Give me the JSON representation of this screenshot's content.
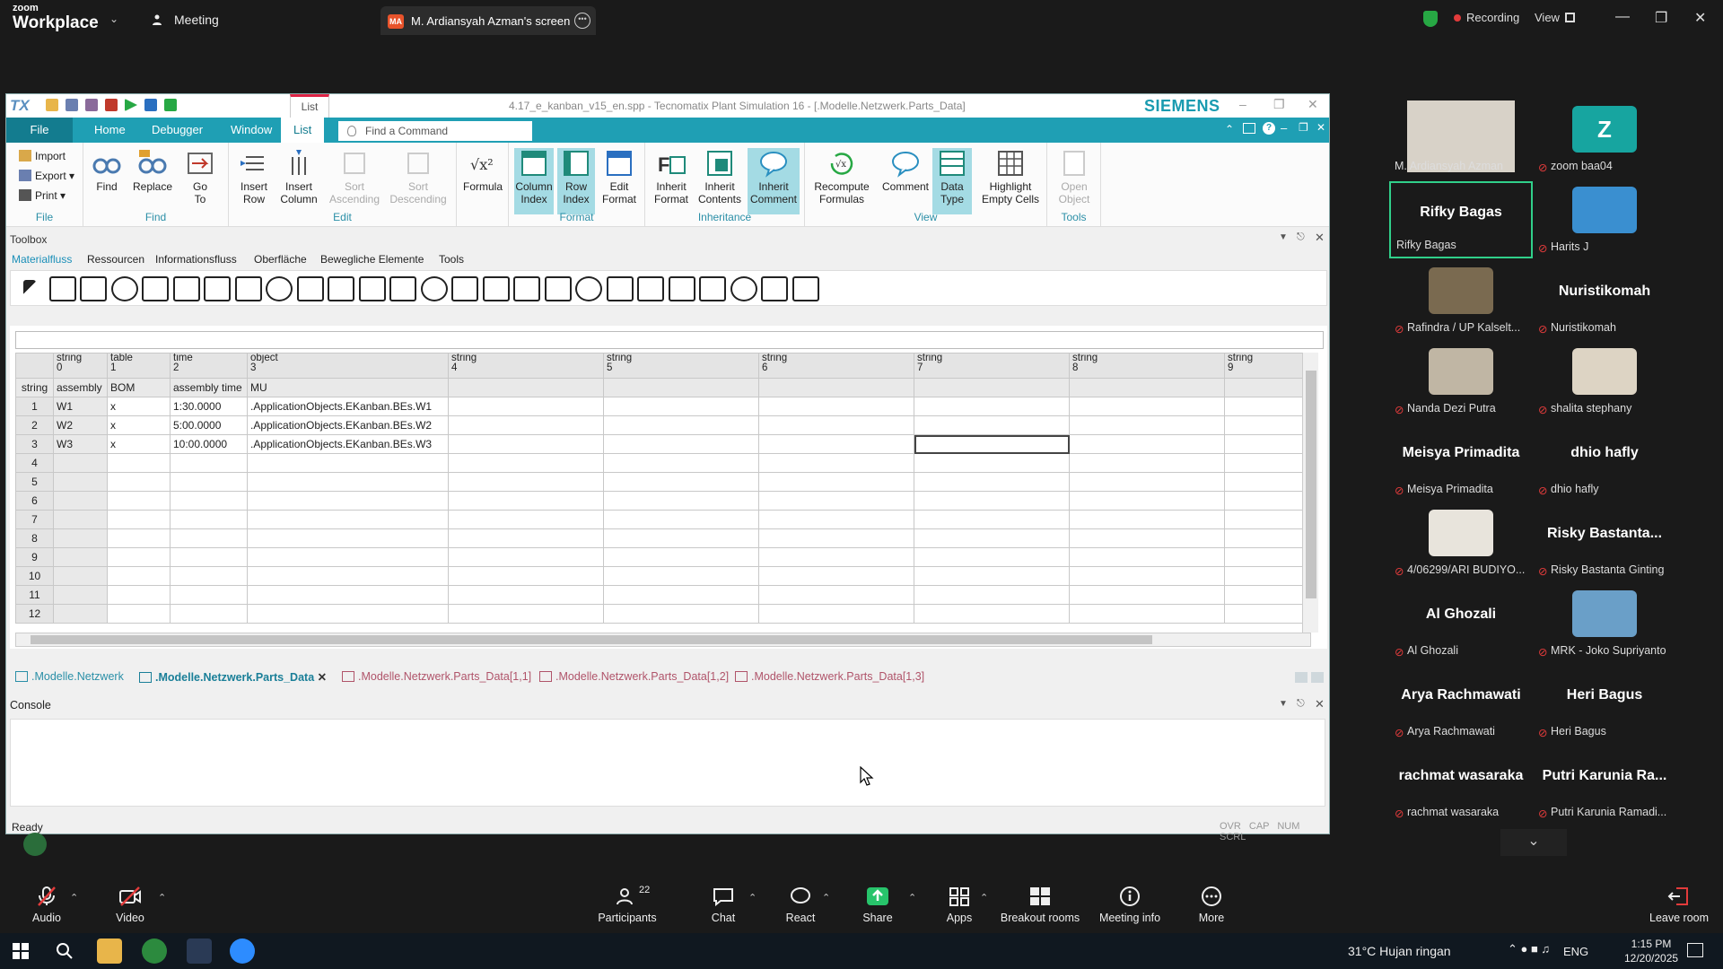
{
  "zoom": {
    "brand_line1": "zoom",
    "brand_line2": "Workplace",
    "meeting_label": "Meeting",
    "share_badge": "MA",
    "share_title": "M. Ardiansyah Azman's screen",
    "recording_label": "Recording",
    "view_label": "View",
    "colors": {
      "bar": "#1a1a1a",
      "recording": "#e23b3b",
      "active_tile": "#30d08a"
    }
  },
  "plantsim": {
    "logo": "TX",
    "list_tab": "List",
    "window_title": "4.17_e_kanban_v15_en.spp - Tecnomatix Plant Simulation 16 - [.Modelle.Netzwerk.Parts_Data]",
    "brand": "SIEMENS",
    "menu": [
      "File",
      "Home",
      "Debugger",
      "Window",
      "List"
    ],
    "find_command_placeholder": "Find a Command",
    "ribbon": {
      "file": {
        "label": "File",
        "items": [
          "Import",
          "Export",
          "Print"
        ]
      },
      "find": {
        "label": "Find",
        "buttons": [
          [
            "Find",
            ""
          ],
          [
            "Replace",
            ""
          ],
          [
            "Go",
            "To"
          ]
        ]
      },
      "edit": {
        "label": "Edit",
        "buttons": [
          [
            "Insert",
            "Row"
          ],
          [
            "Insert",
            "Column"
          ],
          [
            "Sort",
            "Ascending"
          ],
          [
            "Sort",
            "Descending"
          ]
        ]
      },
      "formula": {
        "label": "Formula"
      },
      "format": {
        "label": "Format",
        "buttons": [
          [
            "Column",
            "Index"
          ],
          [
            "Row",
            "Index"
          ],
          [
            "Edit",
            "Format"
          ]
        ]
      },
      "inheritance": {
        "label": "Inheritance",
        "buttons": [
          [
            "Inherit",
            "Format"
          ],
          [
            "Inherit",
            "Contents"
          ],
          [
            "Inherit",
            "Comment"
          ]
        ]
      },
      "view": {
        "label": "View",
        "buttons": [
          [
            "Recompute",
            "Formulas"
          ],
          [
            "Comment",
            ""
          ],
          [
            "Data",
            "Type"
          ],
          [
            "Highlight",
            "Empty Cells"
          ]
        ]
      },
      "tools": {
        "label": "Tools",
        "buttons": [
          [
            "Open",
            "Object"
          ]
        ]
      }
    },
    "toolbox": {
      "title": "Toolbox",
      "tabs": [
        "Materialfluss",
        "Ressourcen",
        "Informationsfluss",
        "Oberfläche",
        "Bewegliche Elemente",
        "Tools"
      ]
    },
    "table": {
      "col_headers": [
        [
          "string",
          "0"
        ],
        [
          "table",
          "1"
        ],
        [
          "time",
          "2"
        ],
        [
          "object",
          "3"
        ],
        [
          "string",
          "4"
        ],
        [
          "string",
          "5"
        ],
        [
          "string",
          "6"
        ],
        [
          "string",
          "7"
        ],
        [
          "string",
          "8"
        ],
        [
          "string",
          "9"
        ]
      ],
      "type_row_header": "string",
      "type_row": [
        "assembly",
        "BOM",
        "assembly time",
        "MU",
        "",
        "",
        "",
        "",
        "",
        ""
      ],
      "rows": [
        {
          "n": "1",
          "cells": [
            "W1",
            "x",
            "1:30.0000",
            ".ApplicationObjects.EKanban.BEs.W1"
          ]
        },
        {
          "n": "2",
          "cells": [
            "W2",
            "x",
            "5:00.0000",
            ".ApplicationObjects.EKanban.BEs.W2"
          ]
        },
        {
          "n": "3",
          "cells": [
            "W3",
            "x",
            "10:00.0000",
            ".ApplicationObjects.EKanban.BEs.W3"
          ]
        },
        {
          "n": "4",
          "cells": []
        },
        {
          "n": "5",
          "cells": []
        },
        {
          "n": "6",
          "cells": []
        },
        {
          "n": "7",
          "cells": []
        },
        {
          "n": "8",
          "cells": []
        },
        {
          "n": "9",
          "cells": []
        },
        {
          "n": "10",
          "cells": []
        },
        {
          "n": "11",
          "cells": []
        },
        {
          "n": "12",
          "cells": []
        }
      ]
    },
    "doc_tabs": [
      ".Modelle.Netzwerk",
      ".Modelle.Netzwerk.Parts_Data",
      ".Modelle.Netzwerk.Parts_Data[1,1]",
      ".Modelle.Netzwerk.Parts_Data[1,2]",
      ".Modelle.Netzwerk.Parts_Data[1,3]"
    ],
    "console_title": "Console",
    "status": "Ready",
    "status_keys": "OVR CAP NUM SCRL",
    "colors": {
      "menu": "#1f9fb4",
      "accent": "#2b8fa7",
      "selected": "#a4dbe4"
    }
  },
  "participants": [
    {
      "big": "",
      "name": "M. Ardiansyah Azman",
      "avatar": "video",
      "muted": false
    },
    {
      "big": "Z",
      "name": "zoom baa04",
      "avatar": "teal",
      "muted": true
    },
    {
      "big": "Rifky Bagas",
      "name": "Rifky Bagas",
      "avatar": "",
      "muted": false,
      "active": true
    },
    {
      "big": "",
      "name": "Harits J",
      "avatar": "sky",
      "muted": true
    },
    {
      "big": "",
      "name": "Rafindra / UP Kalselt...",
      "avatar": "building",
      "muted": true
    },
    {
      "big": "Nuristikomah",
      "name": "Nuristikomah",
      "avatar": "",
      "muted": true
    },
    {
      "big": "",
      "name": "Nanda Dezi Putra",
      "avatar": "city",
      "muted": true
    },
    {
      "big": "",
      "name": "shalita stephany",
      "avatar": "beige",
      "muted": true
    },
    {
      "big": "Meisya Primadita",
      "name": "Meisya Primadita",
      "avatar": "",
      "muted": true
    },
    {
      "big": "dhio hafly",
      "name": "dhio hafly",
      "avatar": "",
      "muted": true
    },
    {
      "big": "",
      "name": "4/06299/ARI BUDIYO...",
      "avatar": "person",
      "muted": true
    },
    {
      "big": "Risky Bastanta...",
      "name": "Risky Bastanta Ginting",
      "avatar": "",
      "muted": true
    },
    {
      "big": "Al Ghozali",
      "name": "Al Ghozali",
      "avatar": "",
      "muted": true
    },
    {
      "big": "",
      "name": "MRK - Joko Supriyanto",
      "avatar": "sea",
      "muted": true
    },
    {
      "big": "Arya Rachmawati",
      "name": "Arya Rachmawati",
      "avatar": "",
      "muted": true
    },
    {
      "big": "Heri Bagus",
      "name": "Heri Bagus",
      "avatar": "",
      "muted": true
    },
    {
      "big": "rachmat wasaraka",
      "name": "rachmat wasaraka",
      "avatar": "",
      "muted": true
    },
    {
      "big": "Putri Karunia Ra...",
      "name": "Putri Karunia Ramadi...",
      "avatar": "",
      "muted": true
    }
  ],
  "toolbar": {
    "audio": "Audio",
    "video": "Video",
    "participants": "Participants",
    "participants_count": "22",
    "chat": "Chat",
    "react": "React",
    "share": "Share",
    "apps": "Apps",
    "breakout": "Breakout rooms",
    "info": "Meeting info",
    "more": "More",
    "leave": "Leave room"
  },
  "taskbar": {
    "weather": "31°C  Hujan ringan",
    "lang": "ENG",
    "time": "1:15 PM",
    "date": "12/20/2025"
  }
}
